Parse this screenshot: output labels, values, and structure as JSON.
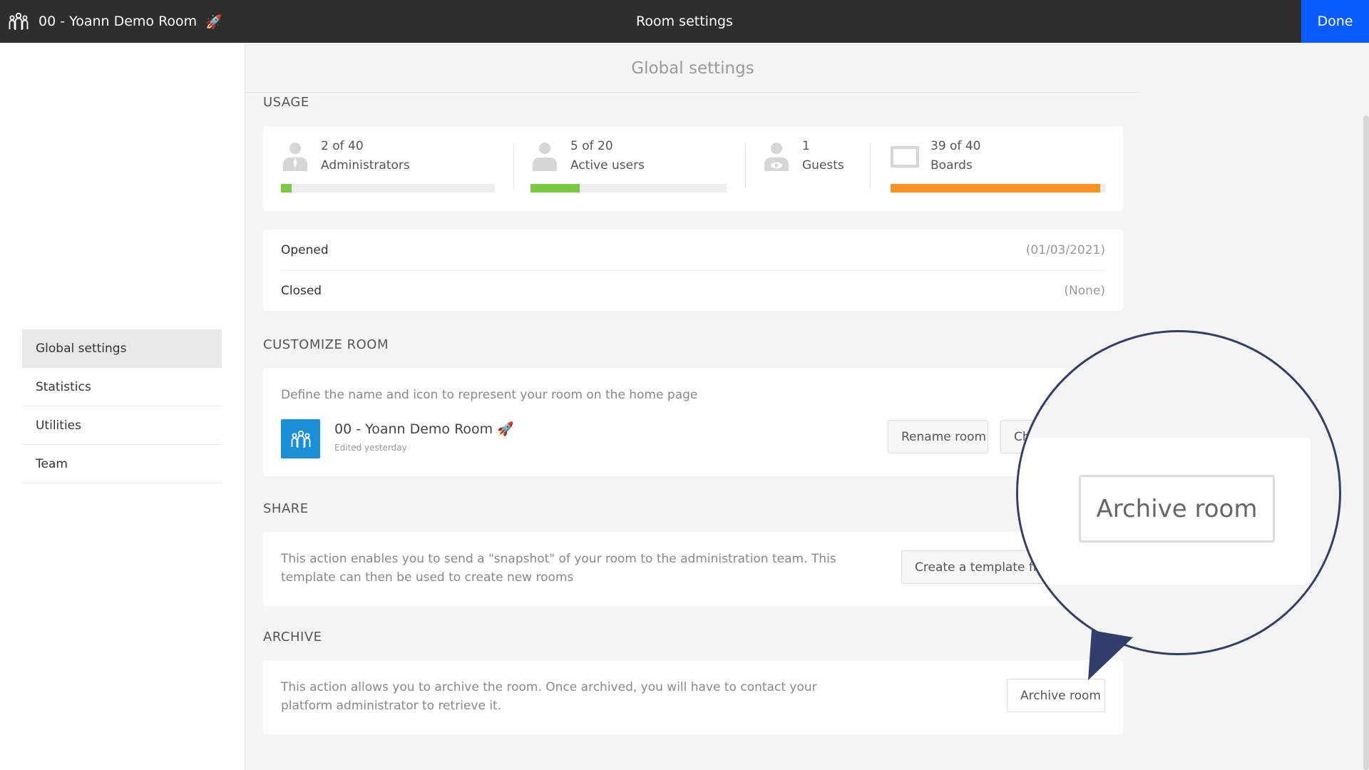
{
  "topbar": {
    "room_name": "00 - Yoann Demo Room",
    "room_emoji": "🚀",
    "title": "Room settings",
    "done_label": "Done"
  },
  "sidebar": {
    "items": [
      {
        "label": "Global settings",
        "active": true
      },
      {
        "label": "Statistics",
        "active": false
      },
      {
        "label": "Utilities",
        "active": false
      },
      {
        "label": "Team",
        "active": false
      }
    ]
  },
  "main": {
    "header": "Global settings",
    "usage": {
      "title": "USAGE",
      "metrics": [
        {
          "value": "2 of 40",
          "label": "Administrators",
          "icon": "admin-user-icon",
          "progress": 0.05,
          "color": "#7ac943"
        },
        {
          "value": "5 of 20",
          "label": "Active users",
          "icon": "user-icon",
          "progress": 0.25,
          "color": "#7ac943"
        },
        {
          "value": "1",
          "label": "Guests",
          "icon": "guest-icon"
        },
        {
          "value": "39 of 40",
          "label": "Boards",
          "icon": "board-icon",
          "progress": 0.975,
          "color": "#f7931e"
        }
      ]
    },
    "dates": {
      "opened_label": "Opened",
      "opened_value": "(01/03/2021)",
      "closed_label": "Closed",
      "closed_value": "(None)"
    },
    "customize": {
      "title": "CUSTOMIZE ROOM",
      "description": "Define the name and icon to represent your room on the home page",
      "room_name": "00 - Yoann Demo Room",
      "room_emoji": "🚀",
      "edited": "Edited yesterday",
      "rename_label": "Rename room",
      "change_label": "Ch"
    },
    "share": {
      "title": "SHARE",
      "description_line1": "This action enables you to send a \"snapshot\" of your room to the administration team. This",
      "description_line2": "template can then be used to create new rooms",
      "button_label": "Create a template from"
    },
    "archive": {
      "title": "ARCHIVE",
      "description_line1": "This action allows you to archive the room. Once archived, you will have to contact your",
      "description_line2": "platform administrator to retrieve it.",
      "button_label": "Archive room"
    },
    "magnifier": {
      "button_label": "Archive room"
    }
  },
  "colors": {
    "topbar": "#2e2e2e",
    "done": "#0a5cff",
    "room_tile": "#1a8fd6",
    "magnifier_ring": "#2f3e6b"
  }
}
